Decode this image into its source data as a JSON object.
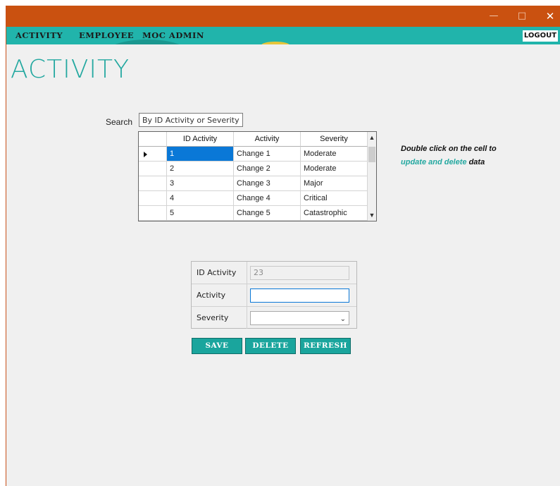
{
  "window": {
    "controls": {
      "minimize": "—",
      "maximize": "□",
      "close": "✕"
    }
  },
  "menu": {
    "items": [
      "ACTIVITY",
      "EMPLOYEE",
      "MOC ADMIN"
    ],
    "logout_label": "LOGOUT"
  },
  "page": {
    "title": "ACTIVITY"
  },
  "search": {
    "label": "Search",
    "placeholder": "By ID Activity or Severity"
  },
  "grid": {
    "columns": [
      "ID Activity",
      "Activity",
      "Severity"
    ],
    "rows": [
      [
        "1",
        "Change 1",
        "Moderate"
      ],
      [
        "2",
        "Change 2",
        "Moderate"
      ],
      [
        "3",
        "Change 3",
        "Major"
      ],
      [
        "4",
        "Change 4",
        "Critical"
      ],
      [
        "5",
        "Change 5",
        "Catastrophic"
      ]
    ],
    "selected_row": 0
  },
  "hint": {
    "line1": "Double click on the cell to",
    "accent": "update and delete",
    "rest": " data"
  },
  "form": {
    "id_label": "ID Activity",
    "id_value": "23",
    "activity_label": "Activity",
    "activity_value": "",
    "severity_label": "Severity",
    "severity_value": ""
  },
  "buttons": {
    "save": "SAVE",
    "delete": "DELETE",
    "refresh": "REFRESH"
  },
  "colors": {
    "titlebar": "#ca5110",
    "menubar": "#21b4ab",
    "accent": "#23a8a0",
    "button": "#1aa59d",
    "selection": "#0a78d7"
  }
}
